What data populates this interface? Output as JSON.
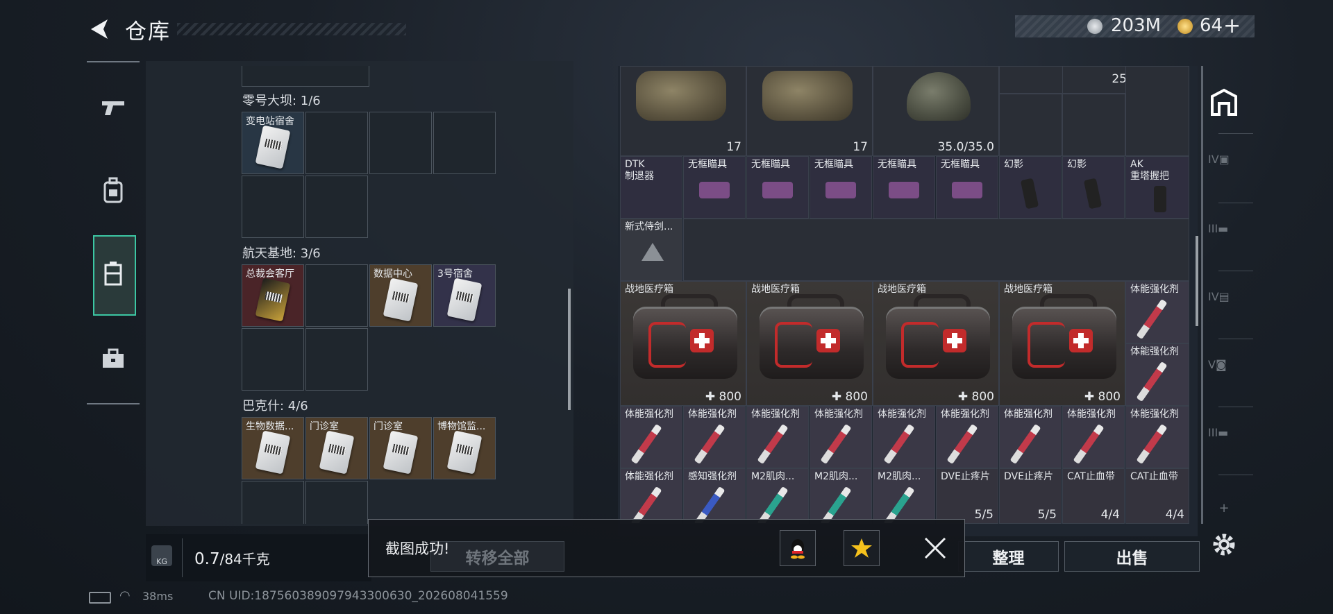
{
  "header": {
    "title": "仓库",
    "currency_1": "203M",
    "currency_2": "64",
    "add_symbol": "+"
  },
  "left": {
    "sections": [
      {
        "label": "零号大坝: 1/6",
        "slots": [
          {
            "name": "变电站宿舍"
          }
        ]
      },
      {
        "label": "航天基地: 3/6",
        "slots": [
          {
            "name": "总裁会客厅"
          },
          {
            "name": ""
          },
          {
            "name": "数据中心"
          },
          {
            "name": "3号宿舍"
          }
        ]
      },
      {
        "label": "巴克什: 4/6",
        "slots": [
          {
            "name": "生物数据..."
          },
          {
            "name": "门诊室"
          },
          {
            "name": "门诊室"
          },
          {
            "name": "博物馆监..."
          }
        ]
      }
    ],
    "weight_current": "0.7",
    "weight_total": "/84千克",
    "weight_icon_label": "KG"
  },
  "grid": {
    "row1": {
      "b1_count": "17",
      "b2_count": "17",
      "helmet_durability": "35.0/35.0",
      "ammo_count": "25"
    },
    "row2": [
      {
        "name": "DTK\n制退器"
      },
      {
        "name": "无框瞄具"
      },
      {
        "name": "无框瞄具"
      },
      {
        "name": "无框瞄具"
      },
      {
        "name": "无框瞄具"
      },
      {
        "name": "无框瞄具"
      },
      {
        "name": "幻影"
      },
      {
        "name": "幻影"
      },
      {
        "name": "AK\n重塔握把"
      }
    ],
    "row3": [
      {
        "name": "新式侍剑..."
      }
    ],
    "medkits": [
      {
        "name": "战地医疗箱",
        "count": "800"
      },
      {
        "name": "战地医疗箱",
        "count": "800"
      },
      {
        "name": "战地医疗箱",
        "count": "800"
      },
      {
        "name": "战地医疗箱",
        "count": "800"
      }
    ],
    "side_col": [
      {
        "name": "体能强化剂"
      },
      {
        "name": "体能强化剂"
      }
    ],
    "row6": [
      {
        "name": "体能强化剂"
      },
      {
        "name": "体能强化剂"
      },
      {
        "name": "体能强化剂"
      },
      {
        "name": "体能强化剂"
      },
      {
        "name": "体能强化剂"
      },
      {
        "name": "体能强化剂"
      },
      {
        "name": "体能强化剂"
      },
      {
        "name": "体能强化剂"
      },
      {
        "name": "体能强化剂"
      }
    ],
    "row7": [
      {
        "name": "体能强化剂",
        "count": ""
      },
      {
        "name": "感知强化剂",
        "count": ""
      },
      {
        "name": "M2肌肉...",
        "count": ""
      },
      {
        "name": "M2肌肉...",
        "count": ""
      },
      {
        "name": "M2肌肉...",
        "count": ""
      },
      {
        "name": "DVE止疼片",
        "count": "5/5"
      },
      {
        "name": "DVE止疼片",
        "count": "5/5"
      },
      {
        "name": "CAT止血带",
        "count": "4/4"
      },
      {
        "name": "CAT止血带",
        "count": "4/4"
      }
    ]
  },
  "actions": {
    "transfer_all": "转移全部",
    "sort": "整理",
    "sell": "出售"
  },
  "toast": {
    "message": "截图成功!"
  },
  "status": {
    "ping": "38ms",
    "uid": "CN UID:187560389097943300630_202608041559"
  },
  "colors": {
    "accent": "#3cc7a3",
    "rare_gold": "#5a4a34",
    "rare_red": "#5a2a2e",
    "rare_purple": "#3a3648"
  }
}
